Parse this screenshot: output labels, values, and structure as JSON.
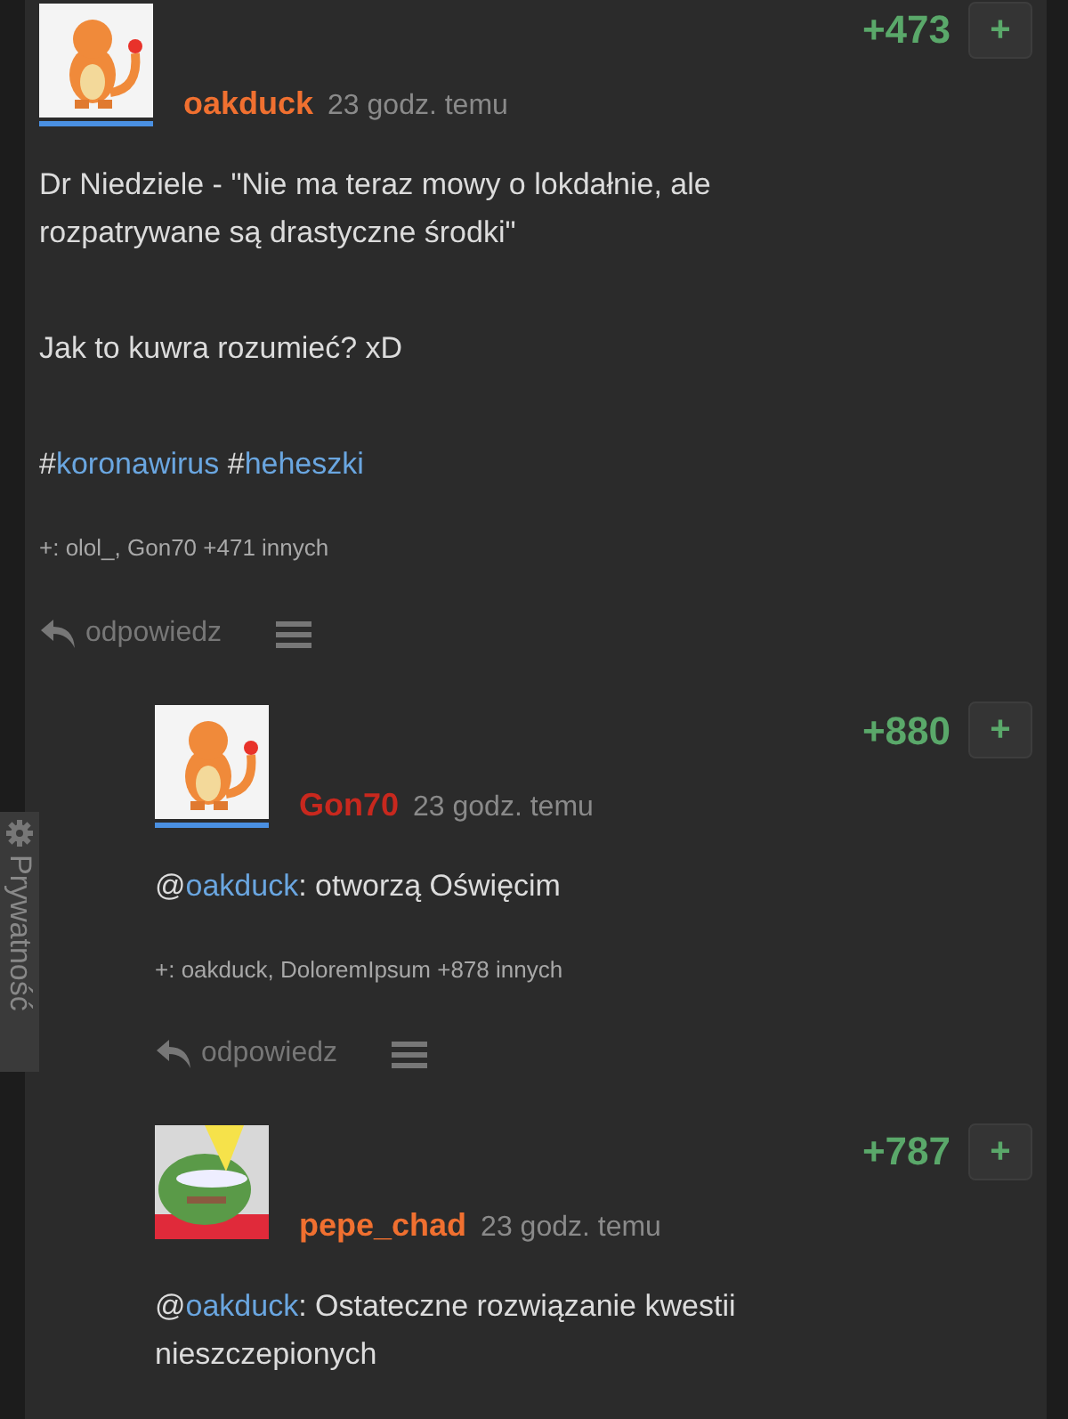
{
  "privacy_tab": {
    "label": "Prywatność"
  },
  "comments": [
    {
      "author": "oakduck",
      "color": "#f07030",
      "time": "23 godz. temu",
      "score": "+473",
      "vote_button": "+",
      "avatar_bar": true,
      "avatar": {
        "kind": "picture"
      },
      "paragraphs": [
        [
          {
            "kind": "plain",
            "text": "Dr Niedziele - \"Nie ma teraz mowy o lokdałnie, ale rozpatrywane są drastyczne środki\""
          }
        ],
        [
          {
            "kind": "plain",
            "text": "Jak to kuwra rozumieć? xD"
          }
        ],
        [
          {
            "kind": "plain",
            "text": "#"
          },
          {
            "kind": "link",
            "text": "koronawirus"
          },
          {
            "kind": "plain",
            "text": " #"
          },
          {
            "kind": "link",
            "text": "heheszki"
          }
        ]
      ],
      "liked_by": "+: olol_, Gon70 +471 innych",
      "reply": "odpowiedz",
      "children": [
        {
          "author": "Gon70",
          "color": "#c8281e",
          "time": "23 godz. temu",
          "score": "+880",
          "vote_button": "+",
          "avatar_bar": true,
          "avatar": {
            "kind": "picture"
          },
          "paragraphs": [
            [
              {
                "kind": "plain",
                "text": "@"
              },
              {
                "kind": "link",
                "text": "oakduck"
              },
              {
                "kind": "plain",
                "text": ": otworzą Oświęcim"
              }
            ]
          ],
          "liked_by": "+: oakduck, DoloremIpsum +878 innych",
          "reply": "odpowiedz"
        },
        {
          "author": "pepe_chad",
          "color": "#f07030",
          "time": "23 godz. temu",
          "score": "+787",
          "vote_button": "+",
          "avatar_bar": false,
          "avatar": {
            "kind": "picture"
          },
          "paragraphs": [
            [
              {
                "kind": "plain",
                "text": "@"
              },
              {
                "kind": "link",
                "text": "oakduck"
              },
              {
                "kind": "plain",
                "text": ": Ostateczne rozwiązanie kwestii nieszczepionych"
              }
            ]
          ]
        }
      ]
    }
  ]
}
